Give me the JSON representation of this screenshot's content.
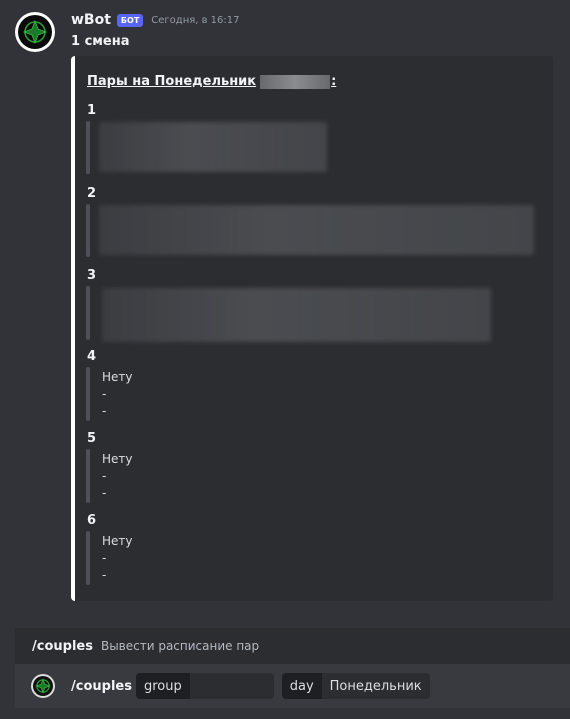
{
  "message": {
    "author": "wBot",
    "badge": "БОТ",
    "timestamp": "Сегодня, в 16:17",
    "subtitle": "1 смена"
  },
  "embed": {
    "title": "Пары на Понедельник",
    "title_suffix": ":",
    "accent_color": "#ffffff",
    "lessons": [
      {
        "number": "1",
        "lines": []
      },
      {
        "number": "2",
        "lines": []
      },
      {
        "number": "3",
        "lines": []
      },
      {
        "number": "4",
        "lines": [
          "Нету",
          "-",
          "-"
        ]
      },
      {
        "number": "5",
        "lines": [
          "Нету",
          "-",
          "-"
        ]
      },
      {
        "number": "6",
        "lines": [
          "Нету",
          "-",
          "-"
        ]
      }
    ]
  },
  "command_suggestion": {
    "name": "/couples",
    "description": "Вывести расписание пар"
  },
  "input": {
    "command": "/couples",
    "options": [
      {
        "label": "group",
        "value": ""
      },
      {
        "label": "day",
        "value": "Понедельник"
      }
    ]
  },
  "icons": {
    "avatar": "bot-avatar-icon",
    "input": "bot-avatar-small-icon"
  }
}
